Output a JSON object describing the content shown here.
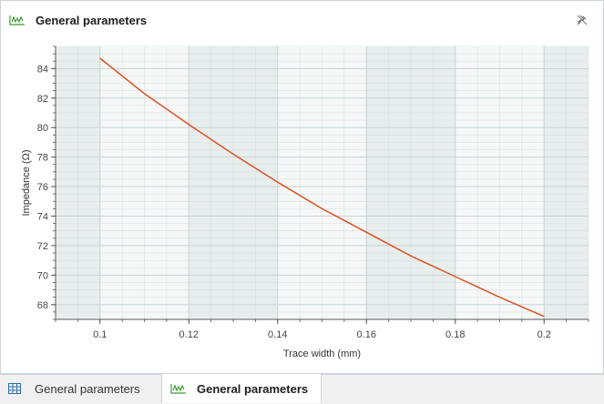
{
  "header": {
    "title": "General parameters",
    "icon": "line-chart-icon",
    "pin_icon": "unpin-icon"
  },
  "tabs": [
    {
      "label": "General parameters",
      "icon": "table-icon",
      "active": false
    },
    {
      "label": "General parameters",
      "icon": "line-chart-icon",
      "active": true
    }
  ],
  "colors": {
    "series": "#e0501f",
    "icon_green": "#3f9c35",
    "icon_blue": "#2f6fb3"
  },
  "chart_data": {
    "type": "line",
    "xlabel": "Trace width (mm)",
    "ylabel": "Impedance (Ω)",
    "xlim": [
      0.09,
      0.21
    ],
    "ylim": [
      67,
      85.5
    ],
    "xticks": [
      0.1,
      0.12,
      0.14,
      0.16,
      0.18,
      0.2
    ],
    "xtick_labels": [
      "0.1",
      "0.12",
      "0.14",
      "0.16",
      "0.18",
      "0.2"
    ],
    "yticks": [
      68,
      70,
      72,
      74,
      76,
      78,
      80,
      82,
      84
    ],
    "ytick_labels": [
      "68",
      "70",
      "72",
      "74",
      "76",
      "78",
      "80",
      "82",
      "84"
    ],
    "grid": true,
    "series": [
      {
        "x": [
          0.1,
          0.11,
          0.12,
          0.13,
          0.14,
          0.15,
          0.16,
          0.17,
          0.18,
          0.19,
          0.2
        ],
        "y": [
          84.7,
          82.3,
          80.2,
          78.2,
          76.3,
          74.5,
          72.9,
          71.3,
          69.9,
          68.5,
          67.2
        ]
      }
    ]
  }
}
